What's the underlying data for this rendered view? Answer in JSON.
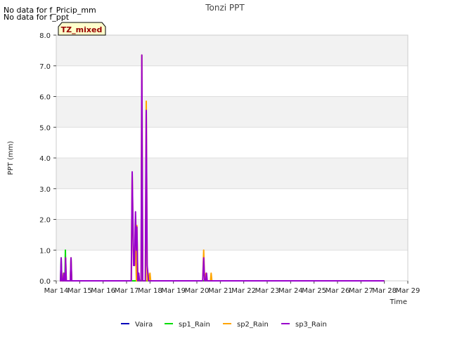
{
  "header": {
    "no_data_lines": [
      "No data for f_Pricip_mm",
      "No data for f_ppt"
    ]
  },
  "badge": {
    "label": "TZ_mixed",
    "bg": "#ffffcc",
    "fg": "#990000"
  },
  "chart_data": {
    "type": "line",
    "title": "Tonzi PPT",
    "xlabel": "Time",
    "ylabel": "PPT (mm)",
    "x_range_days": [
      14,
      29
    ],
    "ylim": [
      0,
      8
    ],
    "x_ticks": [
      "Mar 14",
      "Mar 15",
      "Mar 16",
      "Mar 17",
      "Mar 18",
      "Mar 19",
      "Mar 20",
      "Mar 21",
      "Mar 22",
      "Mar 23",
      "Mar 24",
      "Mar 25",
      "Mar 26",
      "Mar 27",
      "Mar 28",
      "Mar 29"
    ],
    "y_ticks": [
      "0.0",
      "1.0",
      "2.0",
      "3.0",
      "4.0",
      "5.0",
      "6.0",
      "7.0",
      "8.0"
    ],
    "grid": "horizontal bands",
    "legend_position": "bottom",
    "series": [
      {
        "name": "Vaira",
        "color": "#0000bb",
        "points": [
          [
            14.15,
            0
          ],
          [
            28.0,
            0
          ]
        ]
      },
      {
        "name": "sp1_Rain",
        "color": "#00dd00",
        "points": [
          [
            14.15,
            0
          ],
          [
            14.18,
            0
          ],
          [
            14.21,
            0.75
          ],
          [
            14.24,
            0
          ],
          [
            14.29,
            0
          ],
          [
            14.32,
            0.25
          ],
          [
            14.35,
            0
          ],
          [
            14.37,
            0
          ],
          [
            14.39,
            1.0
          ],
          [
            14.41,
            0
          ],
          [
            14.6,
            0
          ],
          [
            14.63,
            0.75
          ],
          [
            14.66,
            0
          ],
          [
            28.0,
            0
          ]
        ]
      },
      {
        "name": "sp2_Rain",
        "color": "orange",
        "points": [
          [
            14.15,
            0
          ],
          [
            14.28,
            0
          ],
          [
            14.31,
            0.25
          ],
          [
            14.34,
            0
          ],
          [
            14.38,
            0
          ],
          [
            14.4,
            0.75
          ],
          [
            14.43,
            0
          ],
          [
            14.6,
            0
          ],
          [
            14.63,
            0.75
          ],
          [
            14.66,
            0
          ],
          [
            17.2,
            0
          ],
          [
            17.24,
            3.5
          ],
          [
            17.3,
            0.5
          ],
          [
            17.38,
            1.25
          ],
          [
            17.42,
            0
          ],
          [
            17.44,
            1.8
          ],
          [
            17.48,
            0
          ],
          [
            17.52,
            0.25
          ],
          [
            17.55,
            0
          ],
          [
            17.62,
            0
          ],
          [
            17.65,
            7.35
          ],
          [
            17.69,
            0
          ],
          [
            17.8,
            0
          ],
          [
            17.84,
            5.85
          ],
          [
            17.88,
            0
          ],
          [
            17.92,
            0.25
          ],
          [
            17.95,
            0
          ],
          [
            18.0,
            0.25
          ],
          [
            18.03,
            0
          ],
          [
            20.25,
            0
          ],
          [
            20.29,
            1.0
          ],
          [
            20.33,
            0
          ],
          [
            20.39,
            0.25
          ],
          [
            20.43,
            0
          ],
          [
            20.58,
            0
          ],
          [
            20.61,
            0.25
          ],
          [
            20.64,
            0
          ],
          [
            28.0,
            0
          ]
        ]
      },
      {
        "name": "sp3_Rain",
        "color": "#9900cc",
        "points": [
          [
            14.15,
            0
          ],
          [
            14.18,
            0
          ],
          [
            14.21,
            0.75
          ],
          [
            14.24,
            0
          ],
          [
            14.29,
            0
          ],
          [
            14.32,
            0.25
          ],
          [
            14.35,
            0
          ],
          [
            14.38,
            0
          ],
          [
            14.4,
            0.75
          ],
          [
            14.43,
            0
          ],
          [
            14.6,
            0
          ],
          [
            14.63,
            0.75
          ],
          [
            14.66,
            0
          ],
          [
            17.2,
            0
          ],
          [
            17.24,
            3.55
          ],
          [
            17.3,
            0.5
          ],
          [
            17.34,
            0.5
          ],
          [
            17.38,
            2.25
          ],
          [
            17.42,
            1.0
          ],
          [
            17.44,
            1.75
          ],
          [
            17.48,
            0
          ],
          [
            17.52,
            0.25
          ],
          [
            17.55,
            0
          ],
          [
            17.62,
            0
          ],
          [
            17.65,
            7.35
          ],
          [
            17.69,
            0
          ],
          [
            17.8,
            0
          ],
          [
            17.84,
            5.55
          ],
          [
            17.88,
            0.5
          ],
          [
            17.91,
            0.25
          ],
          [
            17.94,
            0
          ],
          [
            20.25,
            0
          ],
          [
            20.29,
            0.75
          ],
          [
            20.33,
            0
          ],
          [
            20.38,
            0
          ],
          [
            20.41,
            0.25
          ],
          [
            20.44,
            0
          ],
          [
            28.0,
            0
          ]
        ]
      }
    ]
  }
}
